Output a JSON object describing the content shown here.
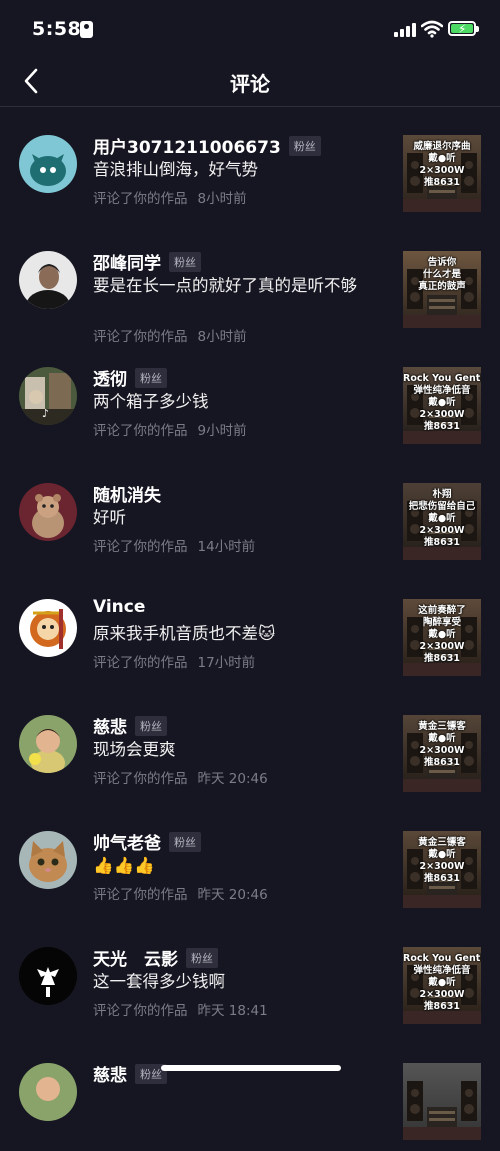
{
  "status": {
    "time": "5:58"
  },
  "header": {
    "title": "评论"
  },
  "comments": [
    {
      "name": "用户3071211006673",
      "fan": true,
      "text": "音浪排山倒海，好气势",
      "meta": "评论了你的作品",
      "time": "8小时前",
      "thumb": [
        "威廉退尔序曲",
        "戴●听",
        "2×300W",
        "推8631"
      ]
    },
    {
      "name": "邵峰同学",
      "fan": true,
      "text": "要是在长一点的就好了真的是听不够",
      "meta": "评论了你的作品",
      "time": "8小时前",
      "thumb": [
        "告诉你",
        "什么才是",
        "真正的鼓声"
      ]
    },
    {
      "name": "透彻",
      "fan": true,
      "text": "两个箱子多少钱",
      "meta": "评论了你的作品",
      "time": "9小时前",
      "thumb": [
        "Rock You Gently",
        "弹性纯净低音",
        "戴●听",
        "2×300W",
        "推8631"
      ]
    },
    {
      "name": "随机消失",
      "fan": false,
      "text": "好听",
      "meta": "评论了你的作品",
      "time": "14小时前",
      "thumb": [
        "朴翔",
        "把悲伤留给自己",
        "戴●听",
        "2×300W",
        "推8631"
      ]
    },
    {
      "name": "Vince",
      "fan": false,
      "text": "原来我手机音质也不差🐱",
      "meta": "评论了你的作品",
      "time": "17小时前",
      "thumb": [
        "这前奏醉了",
        "陶醉享受",
        "戴●听",
        "2×300W",
        "推8631"
      ]
    },
    {
      "name": "慈悲",
      "fan": true,
      "text": "现场会更爽",
      "meta": "评论了你的作品",
      "time": "昨天 20:46",
      "thumb": [
        "黄金三镖客",
        "戴●听",
        "2×300W",
        "推8631"
      ]
    },
    {
      "name": "帅气老爸",
      "fan": true,
      "text": "👍👍👍",
      "meta": "评论了你的作品",
      "time": "昨天 20:46",
      "thumb": [
        "黄金三镖客",
        "戴●听",
        "2×300W",
        "推8631"
      ]
    },
    {
      "name": "天光　云影",
      "fan": true,
      "text": "这一套得多少钱啊",
      "meta": "评论了你的作品",
      "time": "昨天 18:41",
      "thumb": [
        "Rock You Gently",
        "弹性纯净低音",
        "戴●听",
        "2×300W",
        "推8631"
      ]
    },
    {
      "name": "慈悲",
      "fan": true,
      "text": "",
      "meta": "",
      "time": "",
      "thumb": []
    }
  ],
  "fan_label": "粉丝",
  "colors": {
    "background": "#161622",
    "badge_bg": "#2e2e3c",
    "meta": "#7c7c88"
  }
}
